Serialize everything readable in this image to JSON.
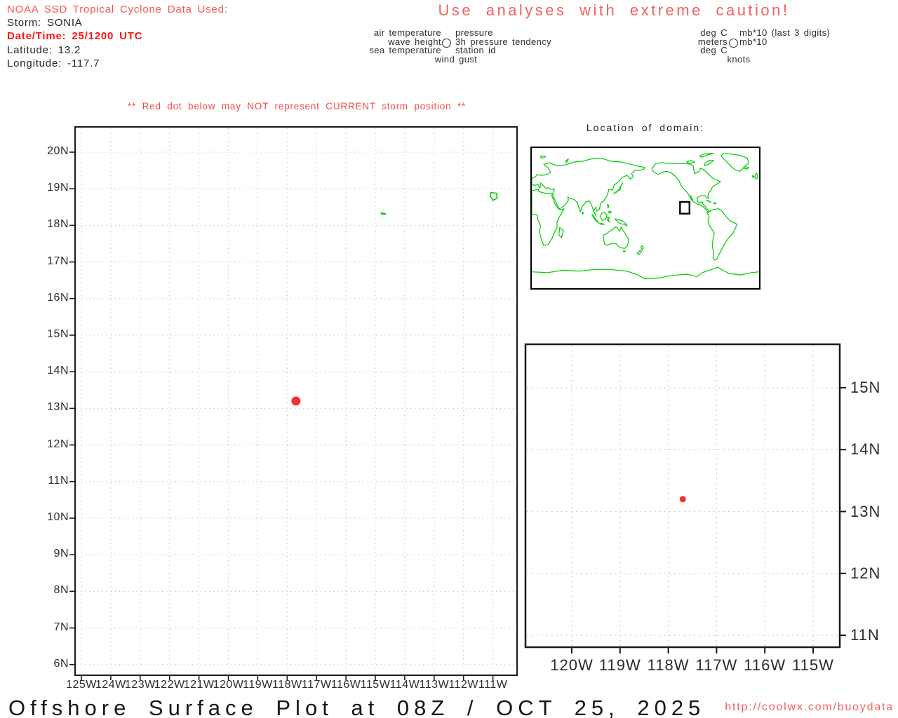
{
  "header": {
    "source_line": "NOAA SSD Tropical Cyclone Data Used:",
    "storm_line": "Storm: SONIA",
    "datetime_line": "Date/Time: 25/1200 UTC",
    "latitude_line": "Latitude: 13.2",
    "longitude_line": "Longitude: -117.7"
  },
  "caution_banner": "Use analyses with extreme caution!",
  "station_model_legend": {
    "left": [
      "air temperature",
      "wave height",
      "sea temperature"
    ],
    "right": [
      "pressure",
      "3h pressure tendency",
      "station id"
    ],
    "bottom": "wind gust"
  },
  "units_legend": {
    "left": [
      "deg C",
      "meters",
      "deg C"
    ],
    "right": [
      "mb*10 (last 3 digits)",
      "mb*10"
    ],
    "bottom": "knots"
  },
  "storm_warning": "** Red dot below may NOT represent CURRENT storm position **",
  "domain_map": {
    "title": "Location of domain:"
  },
  "footer": {
    "title": "Offshore Surface Plot at 08Z / OCT 25, 2025",
    "url": "http://coolwx.com/buoydata"
  },
  "colors": {
    "red_text": "#f85454",
    "bold_red": "#ff1414",
    "storm_dot": "#ee3333",
    "coastline_green": "#00cc00",
    "grid_gray": "#c2c2c2",
    "axis_black": "#1a1a1a"
  },
  "chart_data": [
    {
      "type": "scatter",
      "name": "main_domain_plot",
      "x_tick_labels": [
        "125W",
        "124W",
        "123W",
        "122W",
        "121W",
        "120W",
        "119W",
        "118W",
        "117W",
        "116W",
        "115W",
        "114W",
        "113W",
        "112W",
        "111W"
      ],
      "y_tick_labels": [
        "20N",
        "19N",
        "18N",
        "17N",
        "16N",
        "15N",
        "14N",
        "13N",
        "12N",
        "11N",
        "10N",
        "9N",
        "8N",
        "7N",
        "6N"
      ],
      "xlim": [
        -125.2,
        -110.2
      ],
      "ylim": [
        5.7,
        20.7
      ],
      "grid": true,
      "points": [
        {
          "lon": -117.7,
          "lat": 13.2,
          "label": "storm position (red dot)"
        }
      ],
      "green_features": [
        {
          "lon": -114.72,
          "lat": 18.33
        },
        {
          "lon": -110.95,
          "lat": 18.8
        }
      ]
    },
    {
      "type": "scatter",
      "name": "inset_zoom_plot",
      "x_tick_labels": [
        "120W",
        "119W",
        "118W",
        "117W",
        "116W",
        "115W"
      ],
      "y_tick_labels": [
        "15N",
        "14N",
        "13N",
        "12N",
        "11N"
      ],
      "xlim": [
        -120.95,
        -114.45
      ],
      "ylim": [
        10.8,
        15.7
      ],
      "grid": true,
      "points": [
        {
          "lon": -117.7,
          "lat": 13.2,
          "label": "storm position (red dot)"
        }
      ]
    }
  ]
}
